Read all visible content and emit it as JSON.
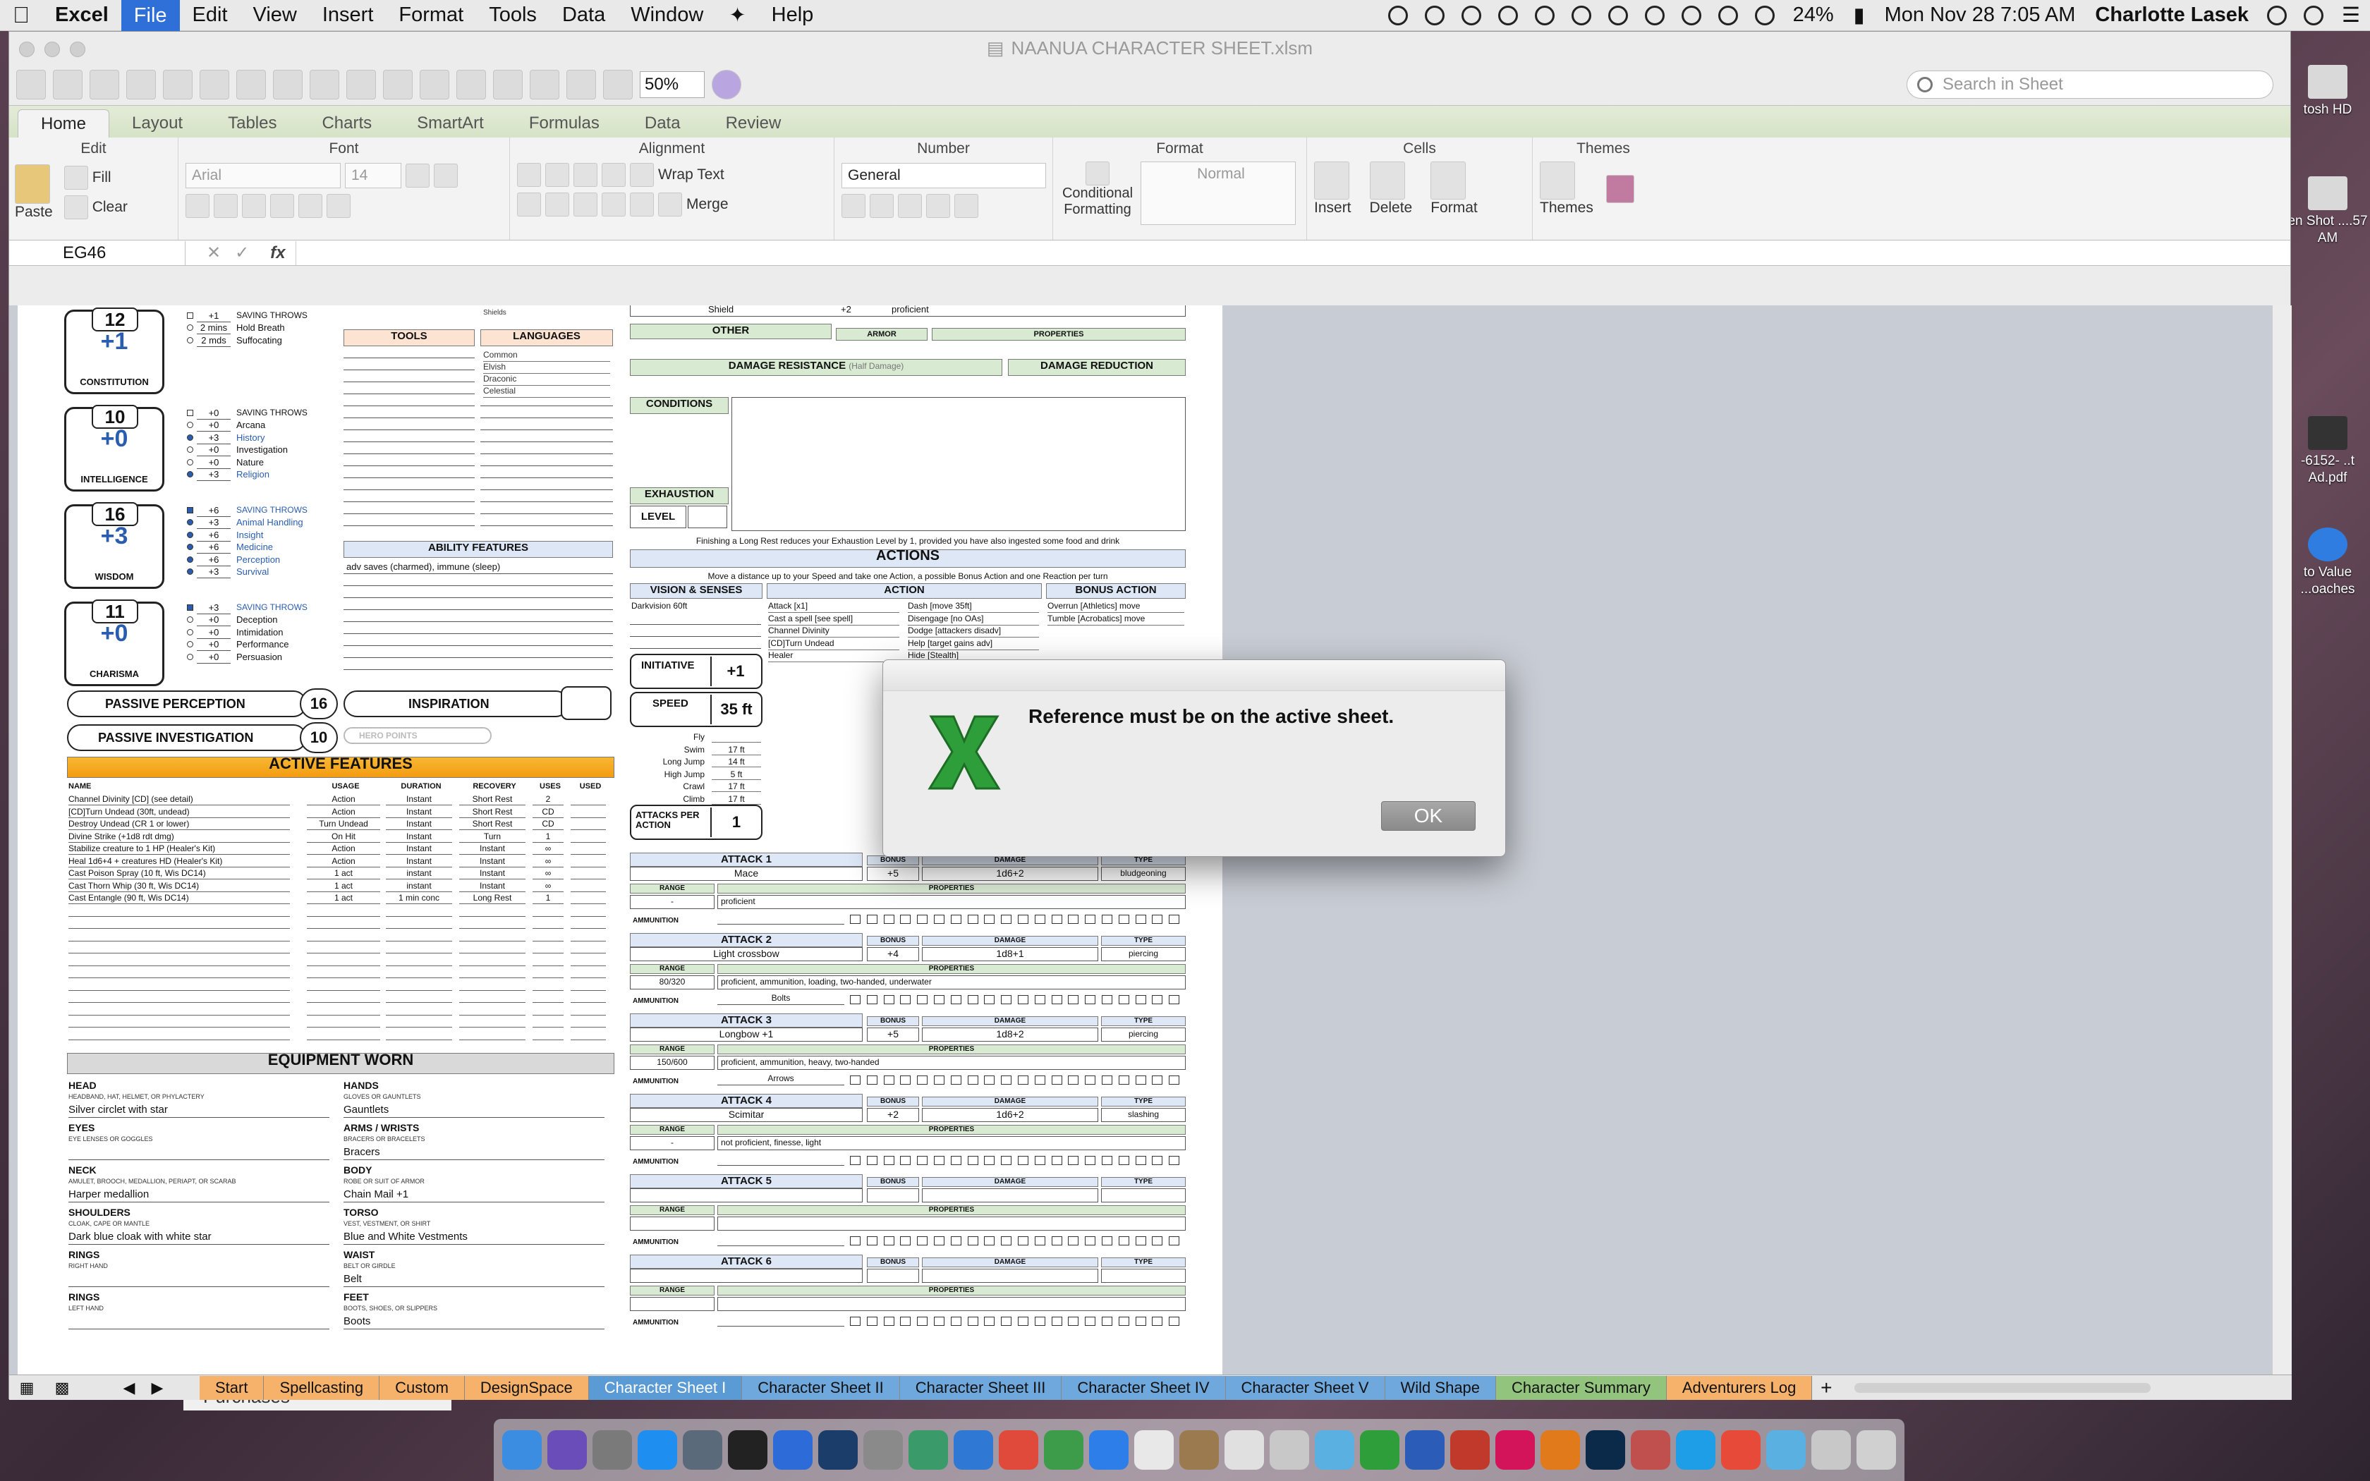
{
  "menubar": {
    "app": "Excel",
    "items": [
      "File",
      "Edit",
      "View",
      "Insert",
      "Format",
      "Tools",
      "Data",
      "Window",
      "Help"
    ],
    "battery": "24%",
    "clock": "Mon Nov 28  7:05 AM",
    "user": "Charlotte Lasek"
  },
  "window": {
    "title": "NAANUA CHARACTER SHEET.xlsm"
  },
  "toolbar": {
    "zoom": "50%",
    "search_placeholder": "Search in Sheet"
  },
  "ribbon_tabs": [
    "Home",
    "Layout",
    "Tables",
    "Charts",
    "SmartArt",
    "Formulas",
    "Data",
    "Review"
  ],
  "ribbon": {
    "edit": "Edit",
    "font": "Font",
    "alignment": "Alignment",
    "number": "Number",
    "format": "Format",
    "cells": "Cells",
    "themes": "Themes",
    "paste": "Paste",
    "fill": "Fill",
    "clear": "Clear",
    "font_name": "Arial",
    "font_size": "14",
    "wrap_text": "Wrap Text",
    "merge": "Merge",
    "number_format": "General",
    "conditional_formatting": "Conditional Formatting",
    "style_normal": "Normal",
    "insert": "Insert",
    "delete": "Delete",
    "format_btn": "Format",
    "themes_btn": "Themes"
  },
  "formula_bar": {
    "cell_ref": "EG46",
    "fx": "fx"
  },
  "sheet": {
    "stats": [
      {
        "score": "12",
        "mod": "+1",
        "name": "CONSTITUTION"
      },
      {
        "score": "10",
        "mod": "+0",
        "name": "INTELLIGENCE"
      },
      {
        "score": "16",
        "mod": "+3",
        "name": "WISDOM"
      },
      {
        "score": "11",
        "mod": "+0",
        "name": "CHARISMA"
      }
    ],
    "con_skills": [
      {
        "v": "+1",
        "t": "SAVING THROWS"
      },
      {
        "v": "2 mins",
        "t": "Hold Breath"
      },
      {
        "v": "2 mds",
        "t": "Suffocating"
      }
    ],
    "int_skills": [
      {
        "v": "+0",
        "t": "SAVING THROWS"
      },
      {
        "v": "+0",
        "t": "Arcana"
      },
      {
        "v": "+3",
        "t": "History"
      },
      {
        "v": "+0",
        "t": "Investigation"
      },
      {
        "v": "+0",
        "t": "Nature"
      },
      {
        "v": "+3",
        "t": "Religion"
      }
    ],
    "wis_skills": [
      {
        "v": "+6",
        "t": "SAVING THROWS"
      },
      {
        "v": "+3",
        "t": "Animal Handling"
      },
      {
        "v": "+6",
        "t": "Insight"
      },
      {
        "v": "+6",
        "t": "Medicine"
      },
      {
        "v": "+6",
        "t": "Perception"
      },
      {
        "v": "+3",
        "t": "Survival"
      }
    ],
    "cha_skills": [
      {
        "v": "+3",
        "t": "SAVING THROWS"
      },
      {
        "v": "+0",
        "t": "Deception"
      },
      {
        "v": "+0",
        "t": "Intimidation"
      },
      {
        "v": "+0",
        "t": "Performance"
      },
      {
        "v": "+0",
        "t": "Persuasion"
      }
    ],
    "tools": "TOOLS",
    "languages": "LANGUAGES",
    "language_list": [
      "Common",
      "Elvish",
      "Draconic",
      "Celestial"
    ],
    "shields": "Shields",
    "ability_features": "ABILITY FEATURES",
    "ability_text": "adv saves (charmed), immune (sleep)",
    "passive_perception": "PASSIVE PERCEPTION",
    "passive_perception_val": "16",
    "passive_investigation": "PASSIVE INVESTIGATION",
    "passive_investigation_val": "10",
    "inspiration": "INSPIRATION",
    "hero_points": "HERO POINTS",
    "active_features": "ACTIVE FEATURES",
    "af_headers": [
      "NAME",
      "USAGE",
      "DURATION",
      "RECOVERY",
      "USES",
      "USED"
    ],
    "af_rows": [
      [
        "Channel Divinity [CD] (see detail)",
        "Action",
        "Instant",
        "Short Rest",
        "2"
      ],
      [
        "[CD]Turn Undead (30ft, undead)",
        "Action",
        "Instant",
        "Short Rest",
        "CD"
      ],
      [
        "Destroy Undead (CR 1 or lower)",
        "Turn Undead",
        "Instant",
        "Short Rest",
        "CD"
      ],
      [
        "Divine Strike (+1d8 rdt dmg)",
        "On Hit",
        "Instant",
        "Turn",
        "1"
      ],
      [
        "Stabilize creature to 1 HP (Healer's Kit)",
        "Action",
        "Instant",
        "Instant",
        "∞"
      ],
      [
        "Heal 1d6+4 + creatures HD (Healer's Kit)",
        "Action",
        "Instant",
        "Instant",
        "∞"
      ],
      [
        "Cast Poison Spray (10 ft, Wis DC14)",
        "1 act",
        "instant",
        "Instant",
        "∞"
      ],
      [
        "Cast Thorn Whip (30 ft, Wis DC14)",
        "1 act",
        "instant",
        "Instant",
        "∞"
      ],
      [
        "Cast Entangle (90 ft, Wis DC14)",
        "1 act",
        "1 min conc",
        "Long Rest",
        "1"
      ]
    ],
    "equipment_worn": "EQUIPMENT WORN",
    "equip_left": [
      {
        "slot": "HEAD",
        "sub": "HEADBAND, HAT, HELMET, OR PHYLACTERY",
        "item": "Silver circlet with star"
      },
      {
        "slot": "EYES",
        "sub": "EYE LENSES OR GOGGLES",
        "item": ""
      },
      {
        "slot": "NECK",
        "sub": "AMULET, BROOCH, MEDALLION, PERIAPT, OR SCARAB",
        "item": "Harper medallion"
      },
      {
        "slot": "SHOULDERS",
        "sub": "CLOAK, CAPE OR MANTLE",
        "item": "Dark blue cloak with white star"
      },
      {
        "slot": "RINGS",
        "sub": "RIGHT HAND",
        "item": ""
      },
      {
        "slot": "RINGS",
        "sub": "LEFT HAND",
        "item": ""
      }
    ],
    "equip_right": [
      {
        "slot": "HANDS",
        "sub": "GLOVES OR GAUNTLETS",
        "item": "Gauntlets"
      },
      {
        "slot": "ARMS / WRISTS",
        "sub": "BRACERS OR BRACELETS",
        "item": "Bracers"
      },
      {
        "slot": "BODY",
        "sub": "ROBE OR SUIT OF ARMOR",
        "item": "Chain Mail +1"
      },
      {
        "slot": "TORSO",
        "sub": "VEST, VESTMENT, OR SHIRT",
        "item": "Blue and White Vestments"
      },
      {
        "slot": "WAIST",
        "sub": "BELT OR GIRDLE",
        "item": "Belt"
      },
      {
        "slot": "FEET",
        "sub": "BOOTS, SHOES, OR SLIPPERS",
        "item": "Boots"
      }
    ],
    "shield_row": {
      "name": "Shield",
      "bonus": "+2",
      "prof": "proficient"
    },
    "other": "OTHER",
    "armor": "ARMOR",
    "properties": "PROPERTIES",
    "damage_resistance": "DAMAGE RESISTANCE",
    "half_damage": "(Half Damage)",
    "damage_reduction": "DAMAGE REDUCTION",
    "conditions": "CONDITIONS",
    "exhaustion": "EXHAUSTION",
    "level": "LEVEL",
    "long_rest_note": "Finishing a Long Rest reduces your Exhaustion Level by 1, provided you have also ingested some food and drink",
    "actions": "ACTIONS",
    "actions_note": "Move a distance up to your Speed and take one Action, a possible Bonus Action and one Reaction per turn",
    "vision": "VISION & SENSES",
    "vision_val": "Darkvision 60ft",
    "action": "ACTION",
    "bonus_action": "BONUS ACTION",
    "action_list": [
      "Attack [x1]",
      "Cast a spell [see spell]",
      "Channel Divinity",
      "[CD]Turn Undead",
      "Healer"
    ],
    "action_list2": [
      "Dash [move 35ft]",
      "Disengage [no OAs]",
      "Dodge [attackers disadv]",
      "Help [target gains adv]",
      "Hide [Stealth]"
    ],
    "bonus_list": [
      "Overrun [Athletics] move",
      "Tumble [Acrobatics] move"
    ],
    "initiative": "INITIATIVE",
    "initiative_val": "+1",
    "speed": "SPEED",
    "speed_val": "35 ft",
    "movement": [
      {
        "k": "Fly",
        "v": ""
      },
      {
        "k": "Swim",
        "v": "17 ft"
      },
      {
        "k": "Long Jump",
        "v": "14 ft"
      },
      {
        "k": "High Jump",
        "v": "5 ft"
      },
      {
        "k": "Crawl",
        "v": "17 ft"
      },
      {
        "k": "Climb",
        "v": "17 ft"
      }
    ],
    "attacks_per_action": "ATTACKS PER ACTION",
    "attacks_val": "1",
    "attacks": [
      {
        "title": "ATTACK 1",
        "name": "Mace",
        "bonus": "+5",
        "damage": "1d6+2",
        "type": "bludgeoning",
        "range": "-",
        "props": "proficient",
        "ammo": ""
      },
      {
        "title": "ATTACK 2",
        "name": "Light crossbow",
        "bonus": "+4",
        "damage": "1d8+1",
        "type": "piercing",
        "range": "80/320",
        "props": "proficient, ammunition, loading, two-handed, underwater",
        "ammo": "Bolts"
      },
      {
        "title": "ATTACK 3",
        "name": "Longbow +1",
        "bonus": "+5",
        "damage": "1d8+2",
        "type": "piercing",
        "range": "150/600",
        "props": "proficient, ammunition, heavy, two-handed",
        "ammo": "Arrows"
      },
      {
        "title": "ATTACK 4",
        "name": "Scimitar",
        "bonus": "+2",
        "damage": "1d6+2",
        "type": "slashing",
        "range": "-",
        "props": "not proficient, finesse, light",
        "ammo": ""
      },
      {
        "title": "ATTACK 5",
        "name": "",
        "bonus": "",
        "damage": "",
        "type": "",
        "range": "",
        "props": "",
        "ammo": ""
      },
      {
        "title": "ATTACK 6",
        "name": "",
        "bonus": "",
        "damage": "",
        "type": "",
        "range": "",
        "props": "",
        "ammo": ""
      }
    ],
    "col_bonus": "BONUS",
    "col_damage": "DAMAGE",
    "col_type": "TYPE",
    "col_range": "RANGE",
    "col_props": "PROPERTIES",
    "col_ammo": "AMMUNITION"
  },
  "sheet_tabs": [
    "Start",
    "Spellcasting",
    "Custom",
    "DesignSpace",
    "Character Sheet I",
    "Character Sheet II",
    "Character Sheet III",
    "Character Sheet IV",
    "Character Sheet V",
    "Wild Shape",
    "Character Summary",
    "Adventurers Log"
  ],
  "tab_colors": [
    "#f6b26b",
    "#f6b26b",
    "#f6b26b",
    "#f6b26b",
    "#6fa8dc",
    "#6fa8dc",
    "#6fa8dc",
    "#6fa8dc",
    "#6fa8dc",
    "#6fa8dc",
    "#93c47d",
    "#f6b26b"
  ],
  "dialog": {
    "message": "Reference must be on the active sheet.",
    "ok": "OK"
  },
  "desktop_icons": [
    "tosh HD",
    "en Shot ....57 AM",
    "-6152- ..t Ad.pdf",
    "to Value ...oaches"
  ],
  "background_window": {
    "label": "Purchases"
  }
}
